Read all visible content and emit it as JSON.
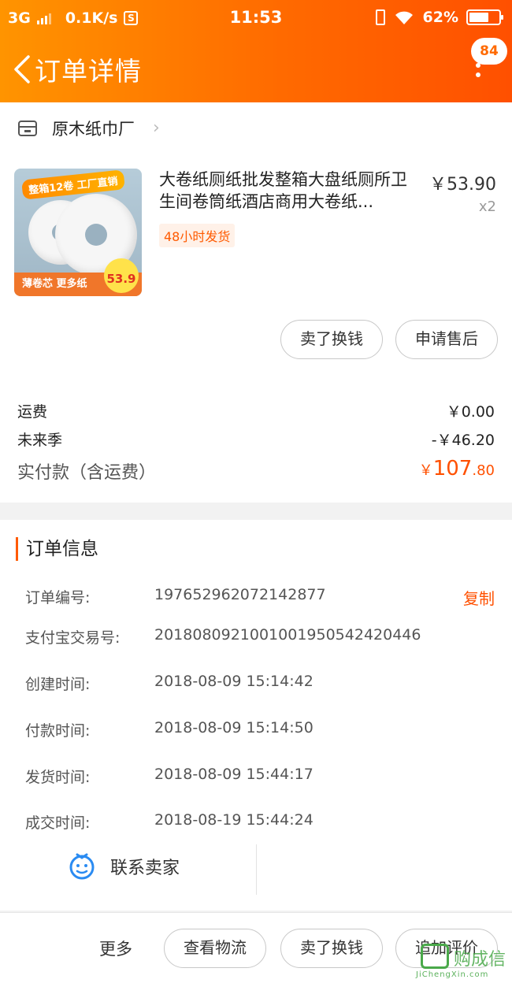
{
  "status_bar": {
    "network": "3G",
    "speed": "0.1K/s",
    "time": "11:53",
    "battery": "62%"
  },
  "nav": {
    "title": "订单详情",
    "badge_count": "84"
  },
  "shop": {
    "name": "原木纸巾厂"
  },
  "product": {
    "title": "大卷纸厕纸批发整箱大盘纸厕所卫生间卷筒纸酒店商用大卷纸...",
    "price": "￥53.90",
    "quantity": "x2",
    "ship_tag": "48小时发货",
    "thumb_banner": "整箱12卷 工厂直销",
    "thumb_bottom": "薄卷芯 更多纸",
    "thumb_price": "53.9"
  },
  "item_actions": {
    "sell": "卖了换钱",
    "after_sale": "申请售后"
  },
  "fees": {
    "shipping_label": "运费",
    "shipping_value": "￥0.00",
    "discount_label": "未来季",
    "discount_value": "-￥46.20",
    "paid_label": "实付款（含运费）",
    "paid_yen": "￥",
    "paid_int": "107",
    "paid_dec": ".80"
  },
  "order_info": {
    "heading": "订单信息",
    "copy_label": "复制",
    "rows": [
      {
        "label": "订单编号:",
        "value": "197652962072142877"
      },
      {
        "label": "支付宝交易号:",
        "value": "2018080921001001950542420446"
      },
      {
        "label": "创建时间:",
        "value": "2018-08-09 15:14:42"
      },
      {
        "label": "付款时间:",
        "value": "2018-08-09 15:14:50"
      },
      {
        "label": "发货时间:",
        "value": "2018-08-09 15:44:17"
      },
      {
        "label": "成交时间:",
        "value": "2018-08-19 15:44:24"
      }
    ],
    "contact_label": "联系卖家"
  },
  "bottom_bar": {
    "more": "更多",
    "logistics": "查看物流",
    "sell": "卖了换钱",
    "review": "追加评价"
  },
  "watermark": {
    "text": "购成信",
    "sub": "JiChengXin.com"
  },
  "colors": {
    "accent": "#ff5000",
    "header_start": "#ff9400",
    "header_end": "#ff5000"
  }
}
